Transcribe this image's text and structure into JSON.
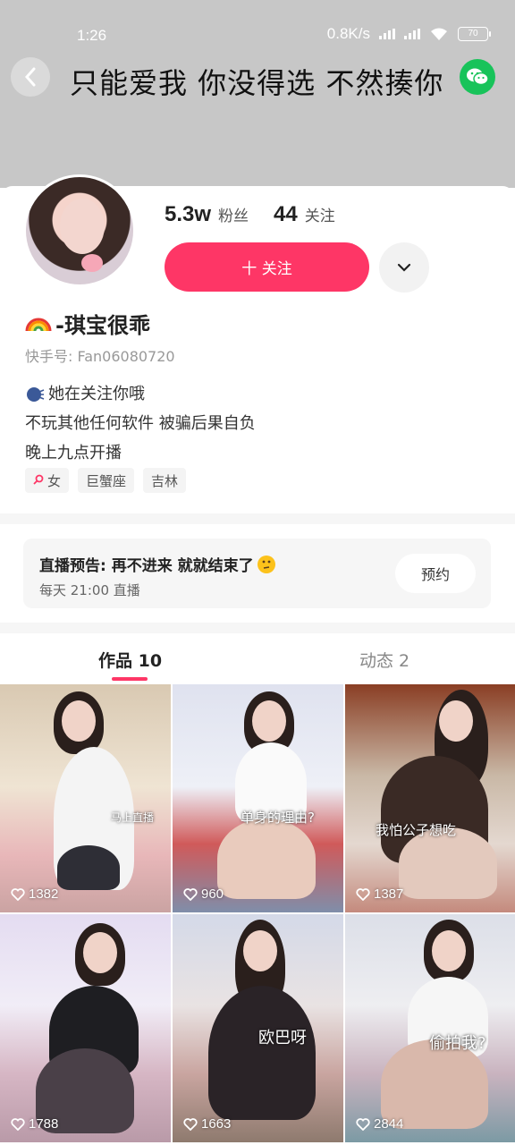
{
  "status_bar": {
    "time": "1:26",
    "network_speed": "0.8K/s",
    "battery": "70"
  },
  "header": {
    "title": "只能爱我 你没得选 不然揍你",
    "back_icon": "back-chevron-icon",
    "share_icon": "wechat-icon"
  },
  "profile": {
    "followers_count": "5.3w",
    "followers_label": "粉丝",
    "following_count": "44",
    "following_label": "关注",
    "follow_button": "十 关注",
    "more_icon": "chevron-down-icon",
    "nickname": "-琪宝很乖",
    "kuaishou_id": "快手号: Fan06080720",
    "bio": [
      "她在关注你哦",
      "不玩其他任何软件 被骗后果自负",
      "晚上九点开播"
    ],
    "tags": [
      "女",
      "巨蟹座",
      "吉林"
    ]
  },
  "live_notice": {
    "title": "直播预告: 再不进来 就就结束了",
    "schedule": "每天 21:00 直播",
    "reserve_button": "预约"
  },
  "tabs": [
    {
      "label": "作品 10"
    },
    {
      "label": "动态 2"
    }
  ],
  "colors": {
    "accent": "#fe3666",
    "cover": "#c7c7c7",
    "wechat": "#18c35a"
  },
  "works": [
    {
      "likes": "1382",
      "caption": "马上直播"
    },
    {
      "likes": "960",
      "caption": "单身的理由?"
    },
    {
      "likes": "1387",
      "caption": "我怕公子想吃"
    },
    {
      "likes": "1788",
      "caption": ""
    },
    {
      "likes": "1663",
      "caption": "欧巴呀"
    },
    {
      "likes": "2844",
      "caption": "偷拍我?"
    }
  ]
}
